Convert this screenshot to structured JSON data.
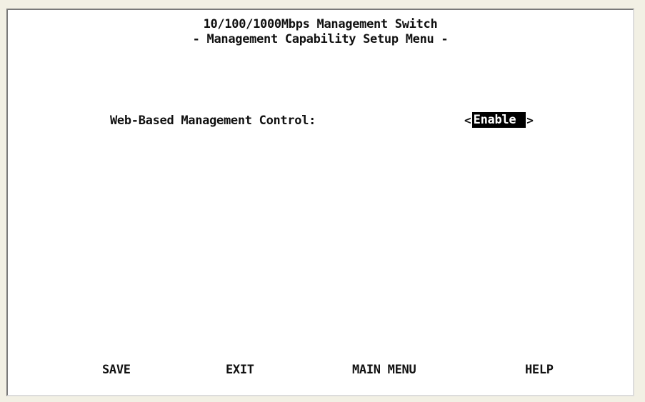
{
  "header": {
    "title": "10/100/1000Mbps Management Switch",
    "subtitle": "- Management Capability Setup Menu -"
  },
  "settings": {
    "web_based_management": {
      "label": "Web-Based Management Control:",
      "value": "Enable",
      "left_bracket": "<",
      "right_bracket": ">"
    }
  },
  "footer": {
    "save": "SAVE",
    "exit": "EXIT",
    "main_menu": "MAIN MENU",
    "help": "HELP"
  }
}
